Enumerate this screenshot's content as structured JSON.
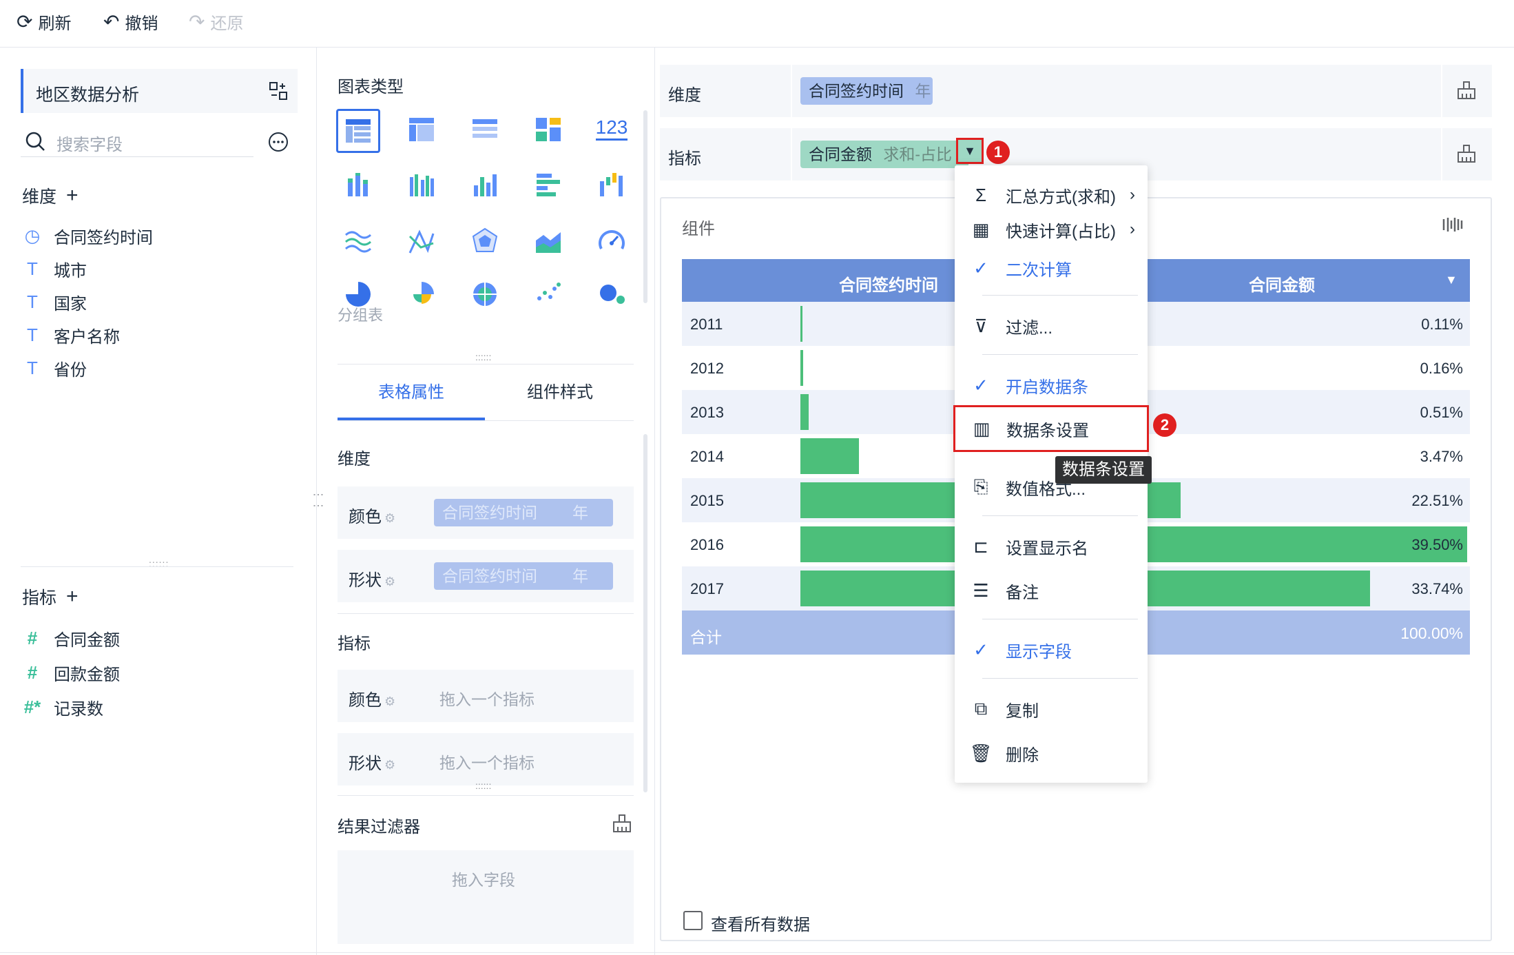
{
  "toolbar": {
    "refresh": "刷新",
    "undo": "撤销",
    "redo": "还原"
  },
  "dataset": {
    "name": "地区数据分析",
    "search_placeholder": "搜索字段"
  },
  "left": {
    "dim_title": "维度",
    "dims": [
      "合同签约时间",
      "城市",
      "国家",
      "客户名称",
      "省份"
    ],
    "meas_title": "指标",
    "measures": [
      "合同金额",
      "回款金额",
      "记录数"
    ]
  },
  "mid": {
    "chart_type_title": "图表类型",
    "chart_123": "123",
    "group_table_label": "分组表",
    "tabs": [
      "表格属性",
      "组件样式"
    ],
    "dim_title": "维度",
    "color_label": "颜色",
    "shape_label": "形状",
    "dim_pill_field": "合同签约时间",
    "dim_pill_unit": "年",
    "meas_title": "指标",
    "drop_meas_placeholder": "拖入一个指标",
    "result_filter_title": "结果过滤器",
    "drop_field_placeholder": "拖入字段"
  },
  "right": {
    "dim_label": "维度",
    "dim_pill_field": "合同签约时间",
    "dim_pill_unit": "年",
    "meas_label": "指标",
    "meas_pill_field": "合同金额",
    "meas_pill_agg": "求和-占比",
    "component_title": "组件",
    "view_all": "查看所有数据"
  },
  "table": {
    "headers": [
      "合同签约时间",
      "合同金额"
    ],
    "rows": [
      {
        "year": "2011",
        "value": "0.11%",
        "share": 0.0011
      },
      {
        "year": "2012",
        "value": "0.16%",
        "share": 0.0016
      },
      {
        "year": "2013",
        "value": "0.51%",
        "share": 0.0051
      },
      {
        "year": "2014",
        "value": "3.47%",
        "share": 0.0347
      },
      {
        "year": "2015",
        "value": "22.51%",
        "share": 0.2251
      },
      {
        "year": "2016",
        "value": "39.50%",
        "share": 0.395
      },
      {
        "year": "2017",
        "value": "33.74%",
        "share": 0.3374
      }
    ],
    "total_label": "合计",
    "total_value": "100.00%",
    "bar_color": "#4cbf7a",
    "header_color": "#6a8fd8"
  },
  "menu": {
    "items": [
      "汇总方式(求和)",
      "快速计算(占比)",
      "二次计算",
      "过滤...",
      "开启数据条",
      "数据条设置",
      "数值格式...",
      "设置显示名",
      "备注",
      "显示字段",
      "复制",
      "删除"
    ],
    "tooltip": "数据条设置",
    "badges": [
      "1",
      "2"
    ]
  }
}
